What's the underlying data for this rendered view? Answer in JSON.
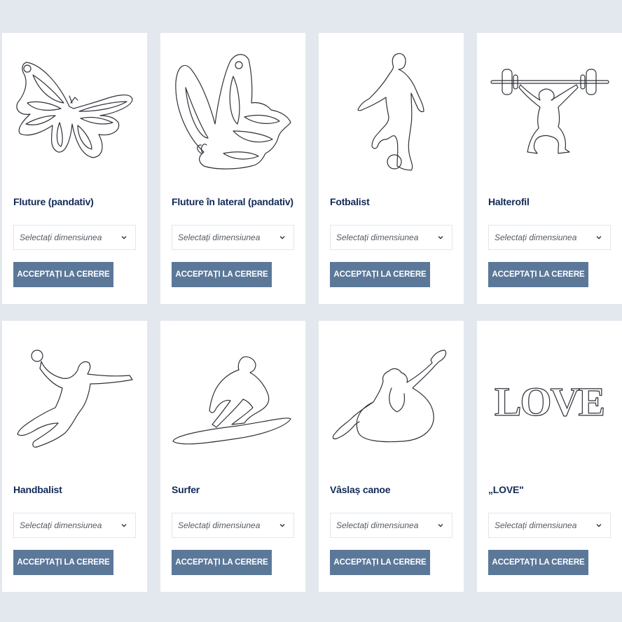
{
  "products": [
    {
      "title": "Fluture (pandativ)",
      "image_icon": "butterfly-pendant-icon",
      "select_placeholder": "Selectați dimensiunea",
      "button_label": "ACCEPTAȚI LA CERERE"
    },
    {
      "title": "Fluture în lateral (pandativ)",
      "image_icon": "butterfly-side-icon",
      "select_placeholder": "Selectați dimensiunea",
      "button_label": "ACCEPTAȚI LA CERERE"
    },
    {
      "title": "Fotbalist",
      "image_icon": "football-player-icon",
      "select_placeholder": "Selectați dimensiunea",
      "button_label": "ACCEPTAȚI LA CERERE"
    },
    {
      "title": "Halterofil",
      "image_icon": "weightlifter-icon",
      "select_placeholder": "Selectați dimensiunea",
      "button_label": "ACCEPTAȚI LA CERERE"
    },
    {
      "title": "Handbalist",
      "image_icon": "handball-player-icon",
      "select_placeholder": "Selectați dimensiunea",
      "button_label": "ACCEPTAȚI LA CERERE"
    },
    {
      "title": "Surfer",
      "image_icon": "surfer-icon",
      "select_placeholder": "Selectați dimensiunea",
      "button_label": "ACCEPTAȚI LA CERERE"
    },
    {
      "title": "Vâslaș canoe",
      "image_icon": "canoe-paddler-icon",
      "select_placeholder": "Selectați dimensiunea",
      "button_label": "ACCEPTAȚI LA CERERE"
    },
    {
      "title": "„LOVE\"",
      "image_icon": "love-text-icon",
      "love_text": "LOVE",
      "select_placeholder": "Selectați dimensiunea",
      "button_label": "ACCEPTAȚI LA CERERE"
    }
  ],
  "colors": {
    "page_background": "#e3e7ee",
    "card_background": "#ffffff",
    "title": "#112a57",
    "button": "#5b7899",
    "button_text": "#ffffff"
  }
}
